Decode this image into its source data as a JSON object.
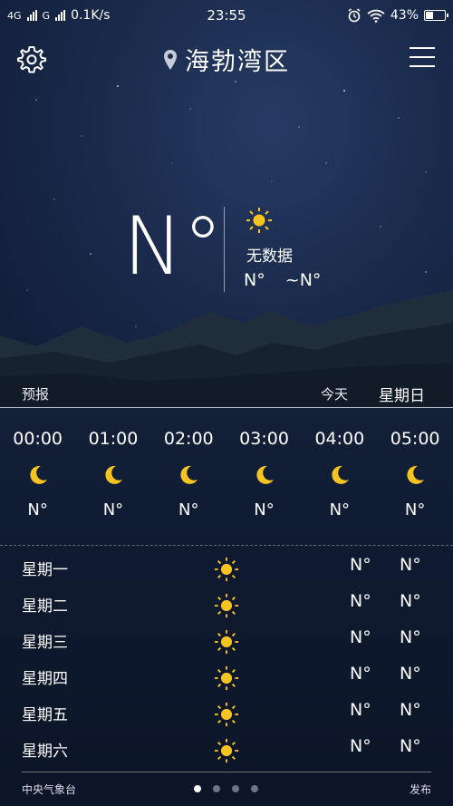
{
  "status_bar": {
    "network1": "4G",
    "network2": "G",
    "speed": "0.1K/s",
    "time": "23:55",
    "battery": "43%",
    "battery_level": 0.43,
    "icons": [
      "signal-icon",
      "alarm-icon",
      "wifi-icon",
      "battery-icon"
    ]
  },
  "header": {
    "city": "海勃湾区",
    "icons": [
      "gear-icon",
      "location-pin-icon",
      "menu-icon"
    ]
  },
  "current": {
    "temp": "N°",
    "condition_icon": "sun-icon",
    "description": "无数据",
    "low": "N°",
    "separator": "~",
    "high": "N°"
  },
  "forecast_bar": {
    "label": "预报",
    "today_label": "今天",
    "weekday": "星期日"
  },
  "hourly": [
    {
      "time": "00:00",
      "icon": "moon-icon",
      "temp": "N°"
    },
    {
      "time": "01:00",
      "icon": "moon-icon",
      "temp": "N°"
    },
    {
      "time": "02:00",
      "icon": "moon-icon",
      "temp": "N°"
    },
    {
      "time": "03:00",
      "icon": "moon-icon",
      "temp": "N°"
    },
    {
      "time": "04:00",
      "icon": "moon-icon",
      "temp": "N°"
    },
    {
      "time": "05:00",
      "icon": "moon-icon",
      "temp": "N°"
    }
  ],
  "daily": [
    {
      "day": "星期一",
      "icon": "sun-icon",
      "high": "N°",
      "low": "N°"
    },
    {
      "day": "星期二",
      "icon": "sun-icon",
      "high": "N°",
      "low": "N°"
    },
    {
      "day": "星期三",
      "icon": "sun-icon",
      "high": "N°",
      "low": "N°"
    },
    {
      "day": "星期四",
      "icon": "sun-icon",
      "high": "N°",
      "low": "N°"
    },
    {
      "day": "星期五",
      "icon": "sun-icon",
      "high": "N°",
      "low": "N°"
    },
    {
      "day": "星期六",
      "icon": "sun-icon",
      "high": "N°",
      "low": "N°"
    }
  ],
  "footer": {
    "source": "中央气象台",
    "publish": "发布",
    "page_count": 4,
    "active_page": 1
  },
  "colors": {
    "sun": "#f7c320",
    "moon": "#f7c320",
    "background": "#0d1628"
  }
}
